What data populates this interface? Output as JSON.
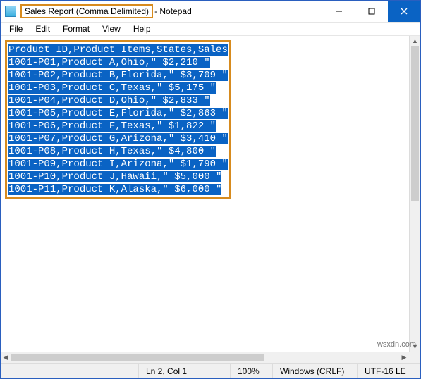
{
  "titlebar": {
    "document_name": "Sales Report (Comma Delimited)",
    "app_suffix": " - Notepad"
  },
  "menu": {
    "file": "File",
    "edit": "Edit",
    "format": "Format",
    "view": "View",
    "help": "Help"
  },
  "content": {
    "header": "Product ID,Product Items,States,Sales",
    "rows": [
      "1001-P01,Product A,Ohio,\" $2,210 \"",
      "1001-P02,Product B,Florida,\" $3,709 \"",
      "1001-P03,Product C,Texas,\" $5,175 \"",
      "1001-P04,Product D,Ohio,\" $2,833 \"",
      "1001-P05,Product E,Florida,\" $2,863 \"",
      "1001-P06,Product F,Texas,\" $1,822 \"",
      "1001-P07,Product G,Arizona,\" $3,410 \"",
      "1001-P08,Product H,Texas,\" $4,800 \"",
      "1001-P09,Product I,Arizona,\" $1,790 \"",
      "1001-P10,Product J,Hawaii,\" $5,000 \"",
      "1001-P11,Product K,Alaska,\" $6,000 \""
    ]
  },
  "statusbar": {
    "position": "Ln 2, Col 1",
    "zoom": "100%",
    "line_ending": "Windows (CRLF)",
    "encoding": "UTF-16 LE"
  },
  "watermark": "wsxdn.com"
}
